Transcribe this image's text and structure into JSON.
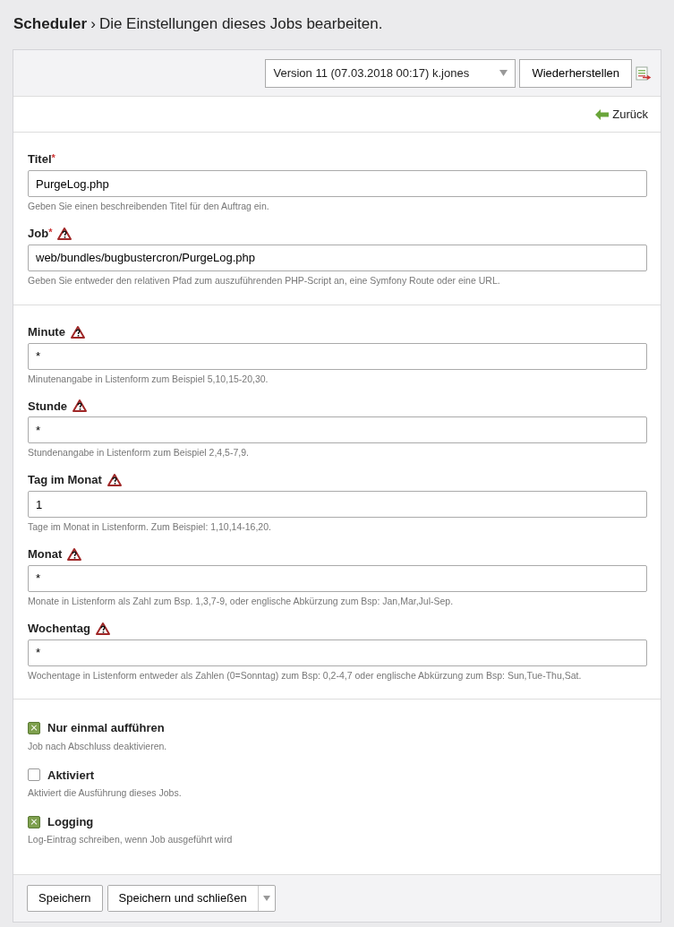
{
  "heading": {
    "module": "Scheduler",
    "separator": "›",
    "title": "Die Einstellungen dieses Jobs bearbeiten."
  },
  "toolbar": {
    "version_select": {
      "value": "Version 11 (07.03.2018 00:17) k.jones"
    },
    "restore_button": "Wiederherstellen"
  },
  "back_link": "Zurück",
  "sections": [
    {
      "fields": [
        {
          "label": "Titel",
          "required_mark": "*",
          "warning": false,
          "value": "PurgeLog.php",
          "help": "Geben Sie einen beschreibenden Titel für den Auftrag ein."
        },
        {
          "label": "Job",
          "required_mark": "*",
          "warning": true,
          "value": "web/bundles/bugbustercron/PurgeLog.php",
          "help": "Geben Sie entweder den relativen Pfad zum auszuführenden PHP-Script an, eine Symfony Route oder eine URL."
        }
      ]
    },
    {
      "fields": [
        {
          "label": "Minute",
          "warning": true,
          "value": "*",
          "help": "Minutenangabe in Listenform zum Beispiel 5,10,15-20,30."
        },
        {
          "label": "Stunde",
          "warning": true,
          "value": "*",
          "help": "Stundenangabe in Listenform zum Beispiel 2,4,5-7,9."
        },
        {
          "label": "Tag im Monat",
          "warning": true,
          "value": "1",
          "help": "Tage im Monat in Listenform. Zum Beispiel: 1,10,14-16,20."
        },
        {
          "label": "Monat",
          "warning": true,
          "value": "*",
          "help": "Monate in Listenform als Zahl zum Bsp. 1,3,7-9, oder englische Abkürzung zum Bsp: Jan,Mar,Jul-Sep."
        },
        {
          "label": "Wochentag",
          "warning": true,
          "value": "*",
          "help": "Wochentage in Listenform entweder als Zahlen (0=Sonntag) zum Bsp: 0,2-4,7 oder englische Abkürzung zum Bsp: Sun,Tue-Thu,Sat."
        }
      ]
    }
  ],
  "options": [
    {
      "label": "Nur einmal aufführen",
      "help": "Job nach Abschluss deaktivieren.",
      "checked": true
    },
    {
      "label": "Aktiviert",
      "help": "Aktiviert die Ausführung dieses Jobs.",
      "checked": false
    },
    {
      "label": "Logging",
      "help": "Log-Eintrag schreiben, wenn Job ausgeführt wird",
      "checked": true
    }
  ],
  "footer": {
    "save_button": "Speichern",
    "save_close_button": "Speichern und schließen"
  }
}
